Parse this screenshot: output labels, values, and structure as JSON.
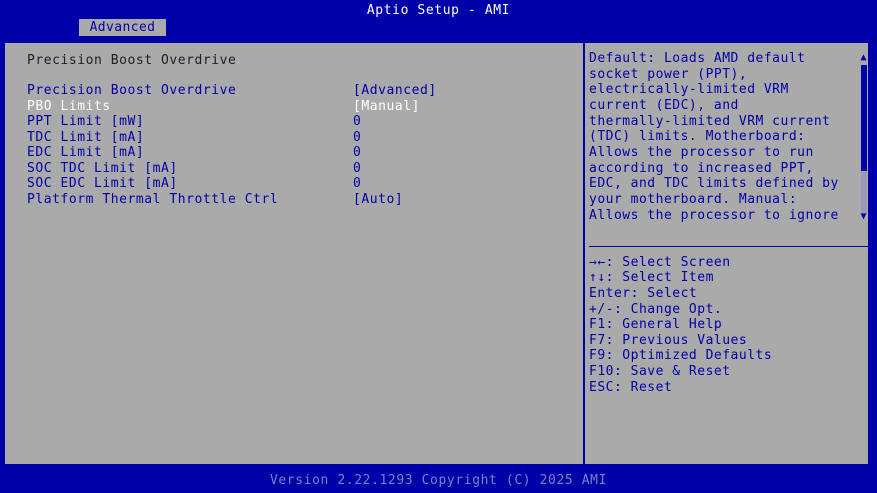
{
  "header": {
    "title": "Aptio Setup - AMI",
    "tab": "Advanced"
  },
  "page": {
    "section_title": "Precision Boost Overdrive",
    "settings": [
      {
        "label": "Precision Boost Overdrive",
        "value": "[Advanced]"
      },
      {
        "label": "PBO Limits",
        "value": "[Manual]"
      },
      {
        "label": "PPT Limit [mW]",
        "value": "0"
      },
      {
        "label": "TDC Limit [mA]",
        "value": "0"
      },
      {
        "label": "EDC Limit [mA]",
        "value": "0"
      },
      {
        "label": "SOC TDC Limit [mA]",
        "value": "0"
      },
      {
        "label": "SOC EDC Limit [mA]",
        "value": "0"
      },
      {
        "label": "Platform Thermal Throttle Ctrl",
        "value": "[Auto]"
      }
    ]
  },
  "help": {
    "lines": [
      "Default: Loads AMD default",
      "socket power (PPT),",
      "electrically-limited VRM",
      "current (EDC), and",
      "thermally-limited VRM current",
      "(TDC) limits. Motherboard:",
      "Allows the processor to run",
      "according to increased PPT,",
      "EDC, and TDC limits defined by",
      "your motherboard. Manual:",
      "Allows the processor to ignore"
    ]
  },
  "keys": [
    "→←: Select Screen",
    "↑↓: Select Item",
    "Enter: Select",
    "+/-: Change Opt.",
    "F1: General Help",
    "F7: Previous Values",
    "F9: Optimized Defaults",
    "F10: Save & Reset",
    "ESC: Reset"
  ],
  "footer": {
    "text": "Version 2.22.1293 Copyright (C) 2025 AMI"
  },
  "colors": {
    "frame": "#0000a8",
    "panel": "#aaaaaa",
    "highlight": "#ffffff"
  },
  "icons": {
    "scroll_up": "triangle-up-icon",
    "scroll_down": "triangle-down-icon"
  }
}
